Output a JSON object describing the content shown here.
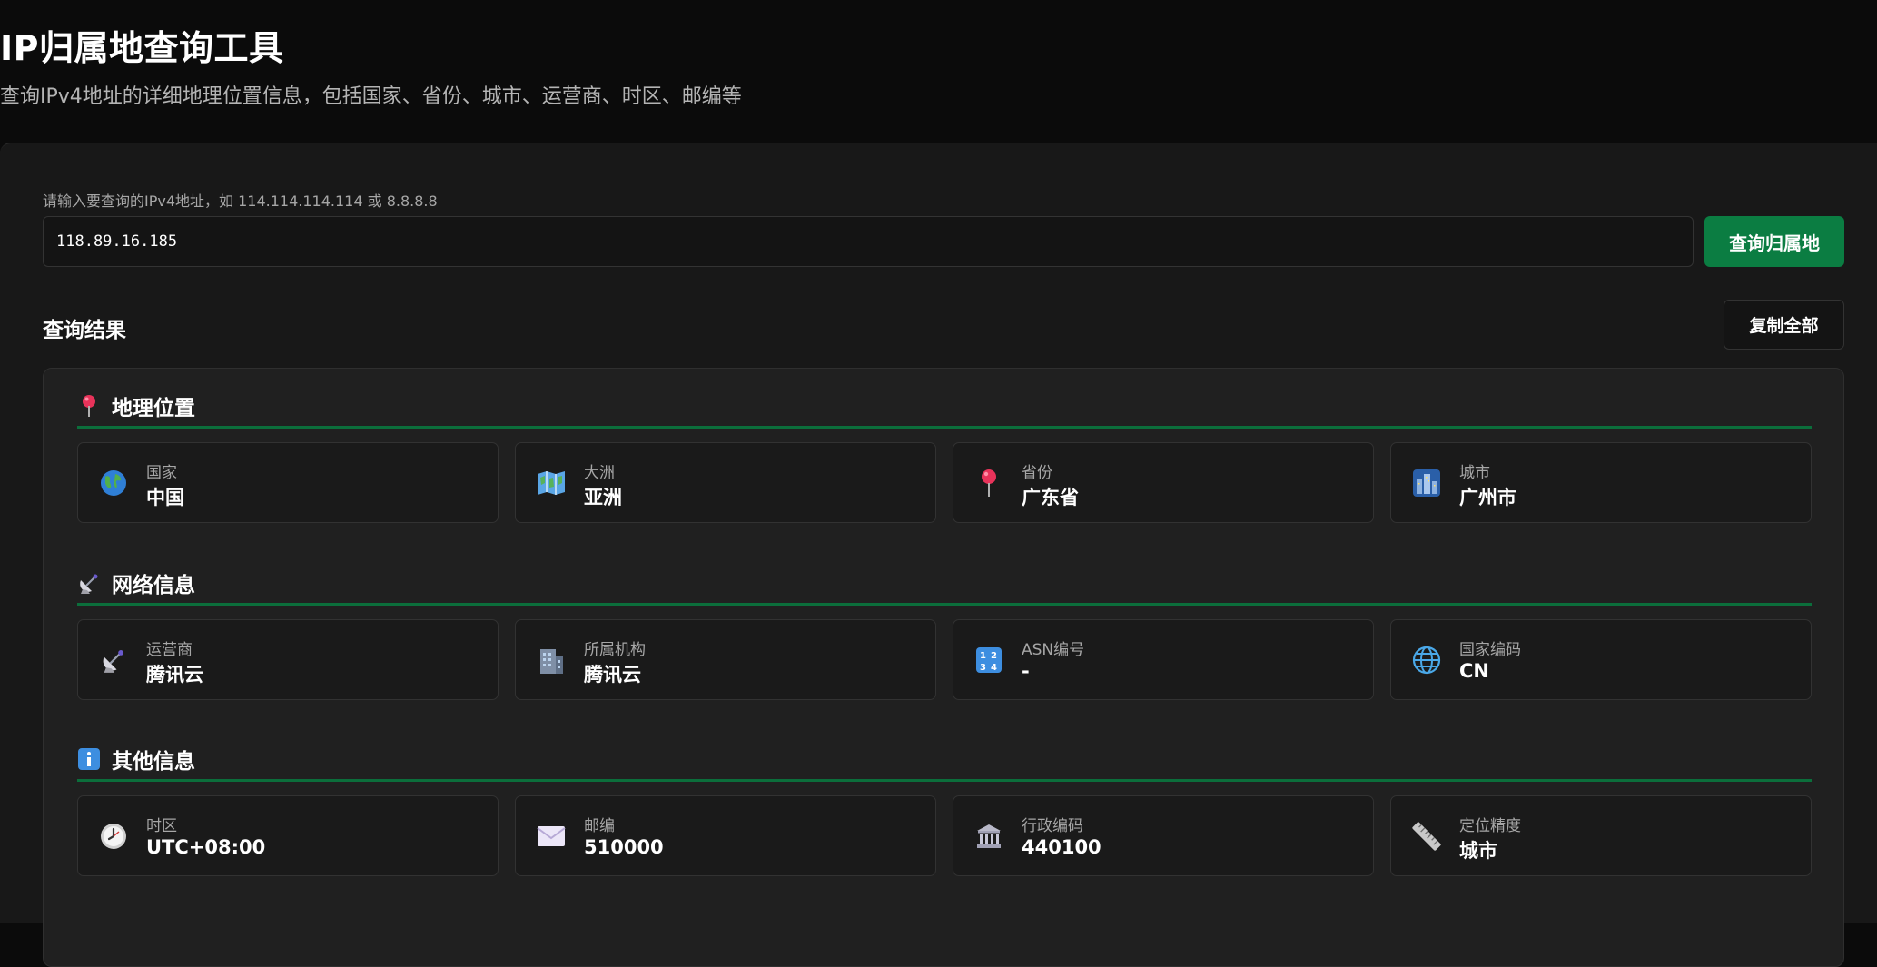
{
  "header": {
    "title": "IP归属地查询工具",
    "subtitle": "查询IPv4地址的详细地理位置信息，包括国家、省份、城市、运营商、时区、邮编等"
  },
  "search": {
    "hint": "请输入要查询的IPv4地址，如 114.114.114.114 或 8.8.8.8",
    "value": "118.89.16.185",
    "button_label": "查询归属地"
  },
  "results": {
    "title": "查询结果",
    "copy_label": "复制全部",
    "sections": [
      {
        "title": "地理位置",
        "icon": "pin-icon",
        "items": [
          {
            "label": "国家",
            "value": "中国",
            "icon": "globe-earth-icon"
          },
          {
            "label": "大洲",
            "value": "亚洲",
            "icon": "map-icon"
          },
          {
            "label": "省份",
            "value": "广东省",
            "icon": "pin-icon"
          },
          {
            "label": "城市",
            "value": "广州市",
            "icon": "city-night-icon"
          }
        ]
      },
      {
        "title": "网络信息",
        "icon": "satellite-dish-icon",
        "items": [
          {
            "label": "运营商",
            "value": "腾讯云",
            "icon": "satellite-dish-icon"
          },
          {
            "label": "所属机构",
            "value": "腾讯云",
            "icon": "office-building-icon"
          },
          {
            "label": "ASN编号",
            "value": "-",
            "icon": "numbers-icon"
          },
          {
            "label": "国家编码",
            "value": "CN",
            "icon": "globe-meridians-icon"
          }
        ]
      },
      {
        "title": "其他信息",
        "icon": "info-icon",
        "items": [
          {
            "label": "时区",
            "value": "UTC+08:00",
            "icon": "clock-icon"
          },
          {
            "label": "邮编",
            "value": "510000",
            "icon": "envelope-icon"
          },
          {
            "label": "行政编码",
            "value": "440100",
            "icon": "government-building-icon"
          },
          {
            "label": "定位精度",
            "value": "城市",
            "icon": "ruler-icon"
          }
        ]
      }
    ]
  },
  "colors": {
    "accent": "#0b7d42",
    "divider": "#0b6e3b",
    "background": "#0b0b0b",
    "panel": "#181818"
  }
}
